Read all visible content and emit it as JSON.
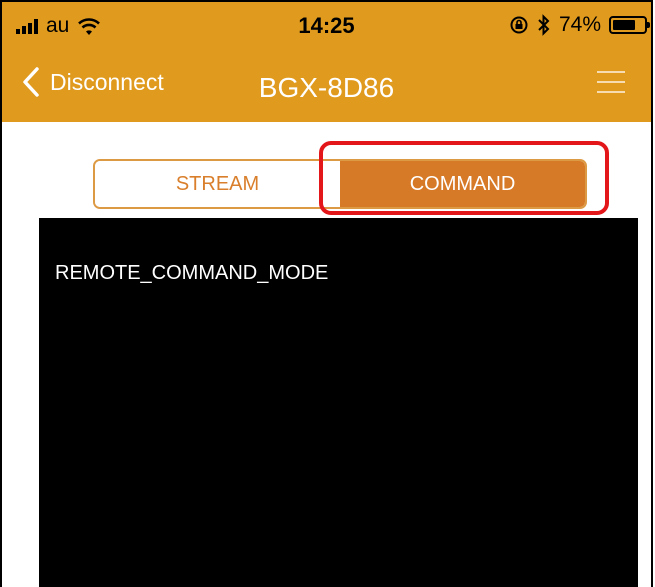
{
  "status_bar": {
    "carrier": "au",
    "time": "14:25",
    "battery_percent_text": "74%",
    "battery_level": 0.74
  },
  "nav": {
    "back_label": "Disconnect",
    "title": "BGX-8D86"
  },
  "segmented": {
    "options": [
      "STREAM",
      "COMMAND"
    ],
    "selected": "COMMAND"
  },
  "terminal": {
    "text": "REMOTE_COMMAND_MODE"
  },
  "colors": {
    "header": "#e09a1d",
    "segment_active": "#d77a27",
    "segment_border": "#dd9a45",
    "highlight": "#e3161a",
    "terminal_bg": "#000000"
  },
  "icons": {
    "signal": "signal-bars-icon",
    "wifi": "wifi-icon",
    "lock_rotation": "orientation-lock-icon",
    "bluetooth": "bluetooth-icon",
    "battery": "battery-icon",
    "back": "chevron-left-icon",
    "menu": "hamburger-menu-icon"
  }
}
